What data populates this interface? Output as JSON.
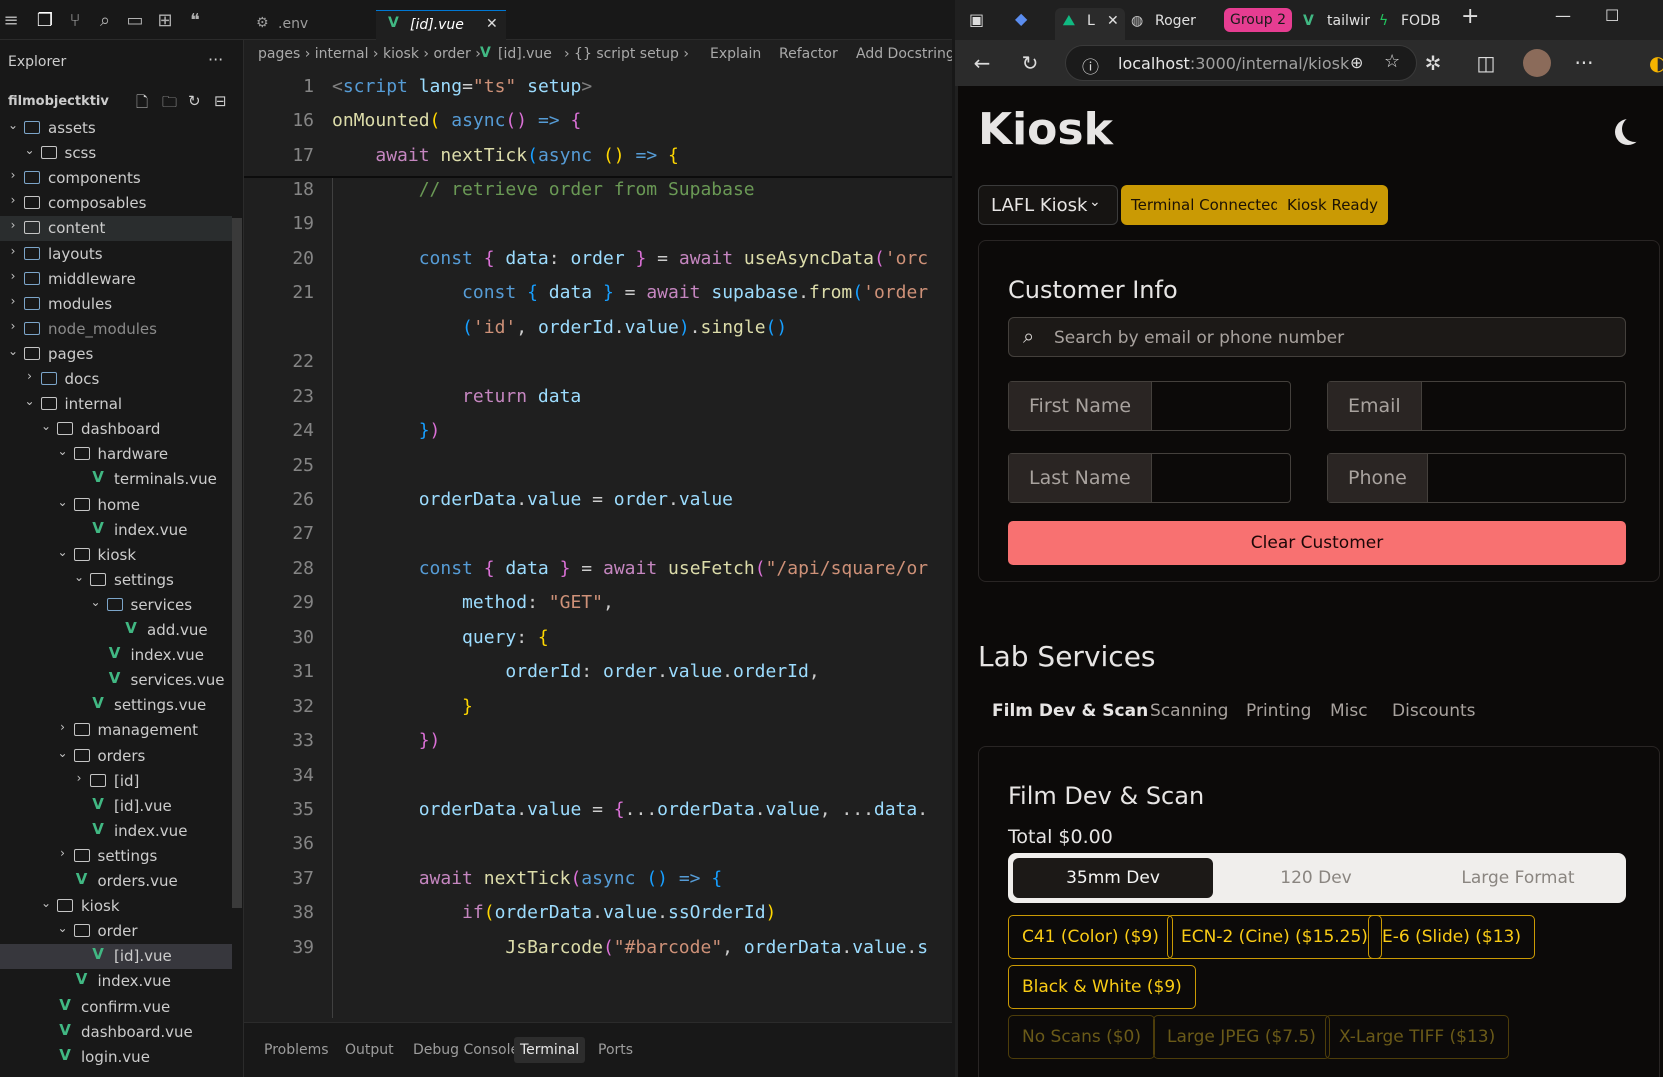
{
  "vscode": {
    "explorer": {
      "title": "Explorer",
      "more": "···",
      "root": "filmobjectktiv",
      "items": [
        {
          "label": "assets",
          "kind": "folder",
          "depth": 0,
          "expanded": true,
          "special": true
        },
        {
          "label": "scss",
          "kind": "folder",
          "depth": 1,
          "expanded": true
        },
        {
          "label": "components",
          "kind": "folder",
          "depth": 0,
          "expanded": false,
          "special": true
        },
        {
          "label": "composables",
          "kind": "folder",
          "depth": 0,
          "expanded": false
        },
        {
          "label": "content",
          "kind": "folder",
          "depth": 0,
          "expanded": false,
          "hover": true
        },
        {
          "label": "layouts",
          "kind": "folder",
          "depth": 0,
          "expanded": false,
          "special": true
        },
        {
          "label": "middleware",
          "kind": "folder",
          "depth": 0,
          "expanded": false,
          "special": true
        },
        {
          "label": "modules",
          "kind": "folder",
          "depth": 0,
          "expanded": false,
          "special": true
        },
        {
          "label": "node_modules",
          "kind": "folder",
          "depth": 0,
          "expanded": false,
          "dim": true,
          "special": true
        },
        {
          "label": "pages",
          "kind": "folder",
          "depth": 0,
          "expanded": true
        },
        {
          "label": "docs",
          "kind": "folder",
          "depth": 1,
          "expanded": false,
          "special": true
        },
        {
          "label": "internal",
          "kind": "folder",
          "depth": 1,
          "expanded": true
        },
        {
          "label": "dashboard",
          "kind": "folder",
          "depth": 2,
          "expanded": true
        },
        {
          "label": "hardware",
          "kind": "folder",
          "depth": 3,
          "expanded": true
        },
        {
          "label": "terminals.vue",
          "kind": "vue",
          "depth": 4
        },
        {
          "label": "home",
          "kind": "folder",
          "depth": 3,
          "expanded": true
        },
        {
          "label": "index.vue",
          "kind": "vue",
          "depth": 4
        },
        {
          "label": "kiosk",
          "kind": "folder",
          "depth": 3,
          "expanded": true
        },
        {
          "label": "settings",
          "kind": "folder",
          "depth": 4,
          "expanded": true
        },
        {
          "label": "services",
          "kind": "folder",
          "depth": 5,
          "expanded": true,
          "special": true
        },
        {
          "label": "add.vue",
          "kind": "vue",
          "depth": 6
        },
        {
          "label": "index.vue",
          "kind": "vue",
          "depth": 5
        },
        {
          "label": "services.vue",
          "kind": "vue",
          "depth": 5
        },
        {
          "label": "settings.vue",
          "kind": "vue",
          "depth": 4
        },
        {
          "label": "management",
          "kind": "folder",
          "depth": 3,
          "expanded": false
        },
        {
          "label": "orders",
          "kind": "folder",
          "depth": 3,
          "expanded": true
        },
        {
          "label": "[id]",
          "kind": "folder",
          "depth": 4,
          "expanded": false
        },
        {
          "label": "[id].vue",
          "kind": "vue",
          "depth": 4
        },
        {
          "label": "index.vue",
          "kind": "vue",
          "depth": 4
        },
        {
          "label": "settings",
          "kind": "folder",
          "depth": 3,
          "expanded": false
        },
        {
          "label": "orders.vue",
          "kind": "vue",
          "depth": 3
        },
        {
          "label": "kiosk",
          "kind": "folder",
          "depth": 2,
          "expanded": true
        },
        {
          "label": "order",
          "kind": "folder",
          "depth": 3,
          "expanded": true
        },
        {
          "label": "[id].vue",
          "kind": "vue",
          "depth": 4,
          "selected": true
        },
        {
          "label": "index.vue",
          "kind": "vue",
          "depth": 3
        },
        {
          "label": "confirm.vue",
          "kind": "vue",
          "depth": 2
        },
        {
          "label": "dashboard.vue",
          "kind": "vue",
          "depth": 2
        },
        {
          "label": "login.vue",
          "kind": "vue",
          "depth": 2
        }
      ]
    },
    "tabs": [
      {
        "label": ".env",
        "icon": "gear-icon",
        "active": false
      },
      {
        "label": "[id].vue",
        "icon": "vue-icon",
        "active": true,
        "close": "✕"
      }
    ],
    "breadcrumb": {
      "path": "pages › internal › kiosk › order › ",
      "file": "[id].vue",
      "symbol": " › {} script setup › ",
      "actions": [
        "Explain",
        "Refactor",
        "Add Docstring"
      ]
    },
    "code_lines": [
      {
        "n": "1",
        "html": "<span class='tagc'>&lt;</span><span class='tag'>script</span> <span class='attr'>lang</span>=<span class='s'>\"ts\"</span> <span class='attr'>setup</span><span class='tagc'>&gt;</span>"
      },
      {
        "n": "16",
        "html": "<span class='f'>onMounted</span><span class='p'>(</span> <span class='k'>async</span><span class='pp'>()</span> <span class='k'>=&gt;</span> <span class='pp'>{</span>"
      },
      {
        "n": "17",
        "html": "    <span class='kw'>await</span> <span class='f'>nextTick</span><span class='b'>(</span><span class='k'>async</span> <span class='p'>()</span> <span class='k'>=&gt;</span> <span class='p'>{</span>"
      },
      {
        "n": "18",
        "html": "        <span class='c'>// retrieve order from Supabase</span>"
      },
      {
        "n": "19",
        "html": ""
      },
      {
        "n": "20",
        "html": "        <span class='k'>const</span> <span class='pp'>{</span> <span class='v'>data</span>: <span class='v'>order</span> <span class='pp'>}</span> = <span class='kw'>await</span> <span class='f'>useAsyncData</span><span class='pp'>(</span><span class='s'>'orc</span>"
      },
      {
        "n": "21",
        "html": "            <span class='k'>const</span> <span class='b'>{</span> <span class='v'>data</span> <span class='b'>}</span> = <span class='kw'>await</span> <span class='v'>supabase</span>.<span class='f'>from</span><span class='b'>(</span><span class='s'>'order</span>"
      },
      {
        "n": "",
        "html": "            <span class='b'>(</span><span class='s'>'id'</span>, <span class='v'>orderId</span>.<span class='v'>value</span><span class='b'>)</span>.<span class='f'>single</span><span class='b'>()</span>"
      },
      {
        "n": "22",
        "html": ""
      },
      {
        "n": "23",
        "html": "            <span class='kw'>return</span> <span class='v'>data</span>"
      },
      {
        "n": "24",
        "html": "        <span class='b'>}</span><span class='pp'>)</span>"
      },
      {
        "n": "25",
        "html": ""
      },
      {
        "n": "26",
        "html": "        <span class='v'>orderData</span>.<span class='v'>value</span> = <span class='v'>order</span>.<span class='v'>value</span>"
      },
      {
        "n": "27",
        "html": ""
      },
      {
        "n": "28",
        "html": "        <span class='k'>const</span> <span class='pp'>{</span> <span class='v'>data</span> <span class='pp'>}</span> = <span class='kw'>await</span> <span class='f'>useFetch</span><span class='pp'>(</span><span class='s'>\"/api/square/or</span>"
      },
      {
        "n": "29",
        "html": "            <span class='v'>method</span>: <span class='s'>\"GET\"</span>,"
      },
      {
        "n": "30",
        "html": "            <span class='v'>query</span>: <span class='p'>{</span>"
      },
      {
        "n": "31",
        "html": "                <span class='v'>orderId</span>: <span class='v'>order</span>.<span class='v'>value</span>.<span class='v'>orderId</span>,"
      },
      {
        "n": "32",
        "html": "            <span class='p'>}</span>"
      },
      {
        "n": "33",
        "html": "        <span class='pp'>})</span>"
      },
      {
        "n": "34",
        "html": ""
      },
      {
        "n": "35",
        "html": "        <span class='v'>orderData</span>.<span class='v'>value</span> = <span class='pp'>{</span>...<span class='v'>orderData</span>.<span class='v'>value</span>, ...<span class='v'>data</span>."
      },
      {
        "n": "36",
        "html": ""
      },
      {
        "n": "37",
        "html": "        <span class='kw'>await</span> <span class='f'>nextTick</span><span class='pp'>(</span><span class='k'>async</span> <span class='b'>()</span> <span class='k'>=&gt;</span> <span class='b'>{</span>"
      },
      {
        "n": "38",
        "html": "            <span class='kw'>if</span><span class='p'>(</span><span class='v'>orderData</span>.<span class='v'>value</span>.<span class='v'>ssOrderId</span><span class='p'>)</span>"
      },
      {
        "n": "39",
        "html": "                <span class='f'>JsBarcode</span><span class='pp'>(</span><span class='s'>\"#barcode\"</span>, <span class='v'>orderData</span>.<span class='v'>value</span>.<span class='v'>s</span>"
      }
    ],
    "panel_tabs": [
      "Problems",
      "Output",
      "Debug Console",
      "Terminal",
      "Ports"
    ],
    "panel_active": "Terminal"
  },
  "browser": {
    "tabs": [
      {
        "label": "L",
        "icon_color": "#10b981",
        "active": true
      },
      {
        "label": "Roger",
        "icon_color": "#5b8def"
      },
      {
        "label": "tailwir",
        "icon_color": "#41b883"
      },
      {
        "label": "FODB",
        "icon_color": "#22c55e"
      }
    ],
    "group_label": "Group 2",
    "close_tab": "✕",
    "new_tab": "+",
    "url_host": "localhost",
    "url_path": ":3000/internal/kiosk",
    "win_controls": [
      "—",
      "☐"
    ]
  },
  "kiosk": {
    "title": "Kiosk",
    "kiosk_select": "LAFL Kiosk",
    "badges": [
      "Terminal Connected",
      "Kiosk Ready"
    ],
    "customer": {
      "title": "Customer Info",
      "search_placeholder": "Search by email or phone number",
      "fields": {
        "first_name": "First Name",
        "email": "Email",
        "last_name": "Last Name",
        "phone": "Phone"
      },
      "clear_button": "Clear Customer"
    },
    "lab_title": "Lab Services",
    "service_tabs": [
      "Film Dev & Scan",
      "Scanning",
      "Printing",
      "Misc",
      "Discounts"
    ],
    "active_service": "Film Dev & Scan",
    "service_card": {
      "title": "Film Dev & Scan",
      "total": "Total $0.00",
      "formats": [
        "35mm Dev",
        "120 Dev",
        "Large Format"
      ],
      "active_format": "35mm Dev",
      "process_options": [
        "C41 (Color) ($9)",
        "ECN-2 (Cine) ($15.25)",
        "E-6 (Slide) ($13)",
        "Black & White ($9)"
      ],
      "scan_options": [
        "No Scans ($0)",
        "Large JPEG ($7.5)",
        "X-Large TIFF ($13)"
      ]
    },
    "colors": {
      "accent": "#ca9a04",
      "danger": "#f87171",
      "background": "#0c0a09"
    }
  }
}
